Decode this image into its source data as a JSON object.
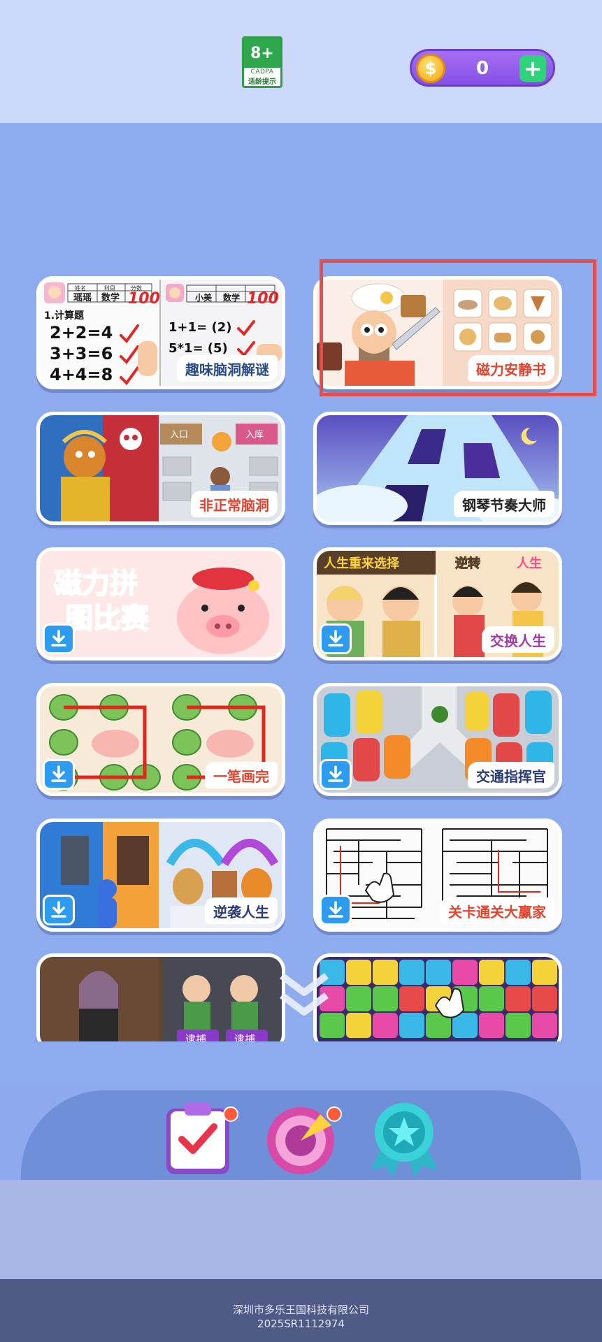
{
  "header": {
    "age_rating": "8+",
    "age_org": "CADPA",
    "age_note": "适龄提示",
    "coins": "0",
    "coin_symbol": "$",
    "add_symbol": "+"
  },
  "games": [
    {
      "title": "趣味脑洞解谜"
    },
    {
      "title": "磁力安静书"
    },
    {
      "title": "非正常脑洞"
    },
    {
      "title": "钢琴节奏大师"
    },
    {
      "title": "磁力拼图比赛"
    },
    {
      "title": "交换人生"
    },
    {
      "title": "一笔画完"
    },
    {
      "title": "交通指挥官"
    },
    {
      "title": "逆袭人生"
    },
    {
      "title": "关卡通关大赢家"
    }
  ],
  "art_text": {
    "math_card": {
      "name1": "瑶瑶",
      "subject1": "数学",
      "score1": "100",
      "name2": "小美",
      "subject2": "数学",
      "score2": "100",
      "heading": "1.计算题",
      "eq1": "2+2=4",
      "eq2": "3+3=6",
      "eq3": "4+4=8",
      "eq4": "1+1= (2)",
      "eq5": "5*1= (5)",
      "col_name": "姓名",
      "col_subject": "科目",
      "col_score": "分数"
    },
    "brain_card": {
      "in_left": "入口",
      "in_right": "入库"
    },
    "life_card": {
      "left": "人生重来选择",
      "right_a": "逆转",
      "right_b": "人生"
    },
    "catch_card": {
      "tag1": "逮捕",
      "tag2": "逮捕"
    }
  },
  "dock": {
    "tasks_icon": "clipboard-check-icon",
    "spin_icon": "spin-target-icon",
    "badge_icon": "award-star-icon"
  },
  "footer": {
    "company": "深圳市多乐王国科技有限公司",
    "reg": "2025SR1112974"
  }
}
